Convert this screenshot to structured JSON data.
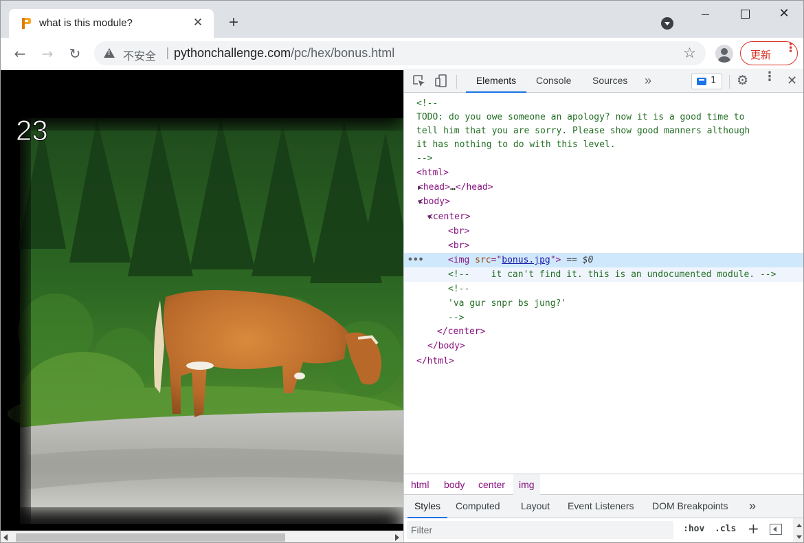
{
  "tab": {
    "title": "what is this module?",
    "close": "✕",
    "new_tab": "+"
  },
  "window": {
    "close": "✕"
  },
  "toolbar": {
    "back": "←",
    "forward": "→",
    "reload": "↻",
    "insecure_label": "不安全",
    "separator": "|",
    "url_host": "pythonchallenge.com",
    "url_path": "/pc/hex/bonus.html",
    "star": "☆",
    "update_label": "更新",
    "update_menu": "⋮"
  },
  "page": {
    "level_number": "23"
  },
  "devtools": {
    "tabs": [
      "Elements",
      "Console",
      "Sources"
    ],
    "more_tabs": "»",
    "issues_count": "1",
    "gear": "⚙",
    "menu": "⋮",
    "close": "✕",
    "dom": {
      "comment_open": "<!--",
      "todo_1": "TODO: do you owe someone an apology? now it is a good time to",
      "todo_2": "tell him that you are sorry. Please show good manners although",
      "todo_3": "it has nothing to do with this level.",
      "comment_close": "-->",
      "html_open": "<html>",
      "head_collapsed_open": "<head>",
      "head_ellipsis": "…",
      "head_close": "</head>",
      "body_open": "<body>",
      "center_open": "<center>",
      "br": "<br>",
      "img_open": "<img ",
      "img_attr_name": "src",
      "img_attr_eq": "=\"",
      "img_attr_value": "bonus.jpg",
      "img_attr_end": "\">",
      "img_eq": " == $0",
      "comment2": "<!--    it can't find it. this is an undocumented module. -->",
      "comment3_open": "<!--",
      "comment3_text": "'va gur snpr bs jung?'",
      "comment3_close": "-->",
      "center_close": "</center>",
      "body_close": "</body>",
      "html_close": "</html>",
      "selected_dots": "•••"
    },
    "breadcrumbs": [
      "html",
      "body",
      "center",
      "img"
    ],
    "styles_tabs": [
      "Styles",
      "Computed",
      "Layout",
      "Event Listeners",
      "DOM Breakpoints"
    ],
    "styles_more": "»",
    "filter_placeholder": "Filter",
    "hov": ":hov",
    "cls": ".cls",
    "plus": "+"
  }
}
